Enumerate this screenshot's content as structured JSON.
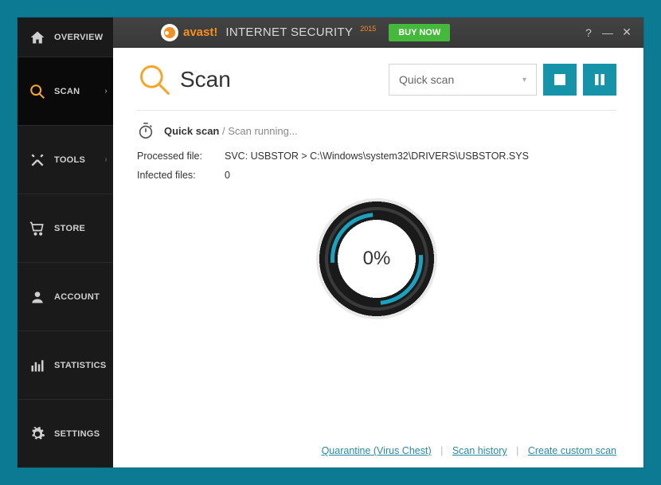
{
  "titlebar": {
    "brand_bang": "avast!",
    "product": "INTERNET SECURITY",
    "year": "2015",
    "buy_label": "BUY NOW",
    "help": "?",
    "min": "—",
    "close": "✕"
  },
  "sidebar": {
    "overview": "OVERVIEW",
    "scan": "SCAN",
    "tools": "TOOLS",
    "store": "STORE",
    "account": "ACCOUNT",
    "statistics": "STATISTICS",
    "settings": "SETTINGS"
  },
  "page": {
    "title": "Scan",
    "dropdown": "Quick scan"
  },
  "status": {
    "type": "Quick scan",
    "sep": " / ",
    "state": "Scan running..."
  },
  "details": {
    "processed_label": "Processed file:",
    "processed_value": "SVC: USBSTOR > C:\\Windows\\system32\\DRIVERS\\USBSTOR.SYS",
    "infected_label": "Infected files:",
    "infected_value": "0"
  },
  "progress": {
    "text": "0%"
  },
  "footer": {
    "quarantine": "Quarantine (Virus Chest)",
    "history": "Scan history",
    "custom": "Create custom scan"
  }
}
